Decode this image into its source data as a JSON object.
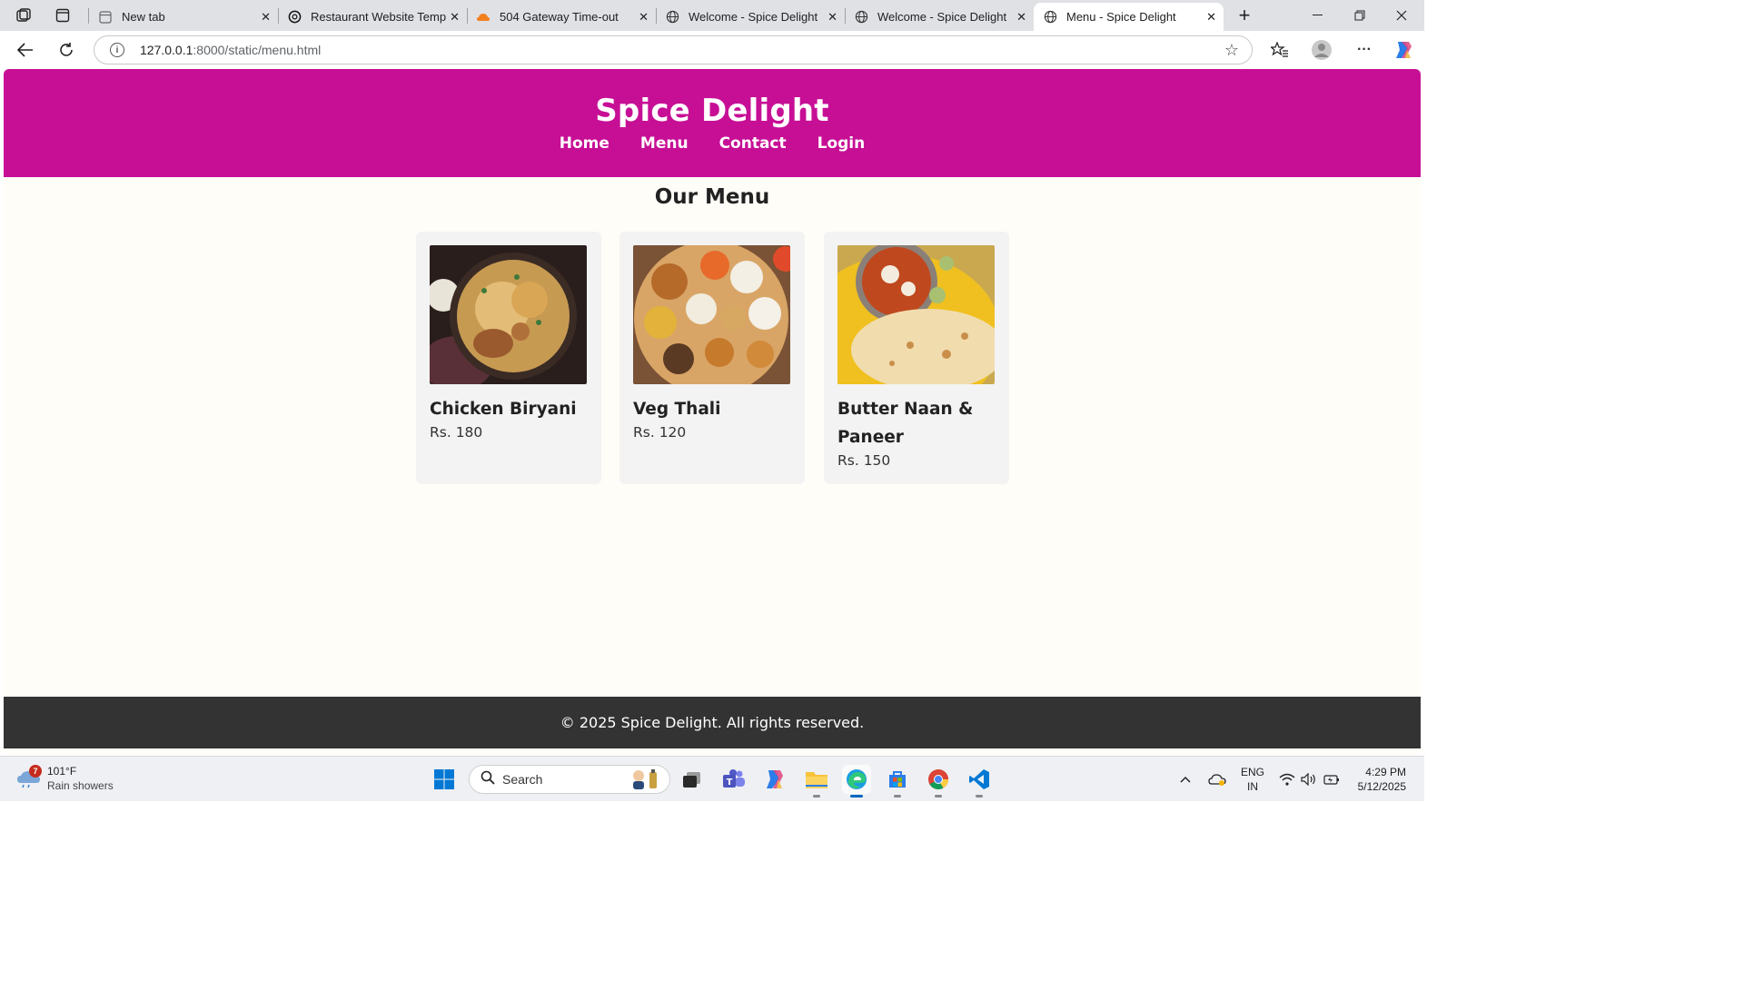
{
  "browser": {
    "tabs": [
      {
        "title": "New tab",
        "icon": "new-tab-icon"
      },
      {
        "title": "Restaurant Website Templa",
        "icon": "chatgpt-icon"
      },
      {
        "title": "504 Gateway Time-out",
        "icon": "cloud-icon"
      },
      {
        "title": "Welcome - Spice Delight",
        "icon": "globe-icon"
      },
      {
        "title": "Welcome - Spice Delight",
        "icon": "globe-icon"
      },
      {
        "title": "Menu - Spice Delight",
        "icon": "globe-icon",
        "active": true
      }
    ],
    "url_host": "127.0.0.1",
    "url_path": ":8000/static/menu.html"
  },
  "site": {
    "title": "Spice Delight",
    "nav": [
      "Home",
      "Menu",
      "Contact",
      "Login"
    ],
    "brand_color": "#c70f96",
    "heading": "Our Menu",
    "items": [
      {
        "name": "Chicken Biryani",
        "price": "Rs. 180"
      },
      {
        "name": "Veg Thali",
        "price": "Rs. 120"
      },
      {
        "name": "Butter Naan & Paneer",
        "price": "Rs. 150"
      }
    ],
    "footer": "© 2025 Spice Delight. All rights reserved."
  },
  "taskbar": {
    "weather_badge": "7",
    "temperature": "101°F",
    "weather_desc": "Rain showers",
    "search_placeholder": "Search",
    "lang_top": "ENG",
    "lang_bottom": "IN",
    "time": "4:29 PM",
    "date": "5/12/2025"
  }
}
